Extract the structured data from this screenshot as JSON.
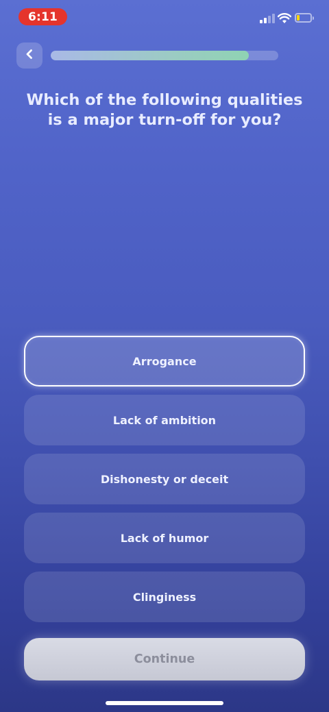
{
  "status_bar": {
    "time": "6:11",
    "signal_bars": 2,
    "battery_level": 0.2,
    "time_pill_color": "#e5342c",
    "battery_fill_color": "#ffd60a"
  },
  "nav": {
    "back_icon": "chevron-left-icon",
    "progress": 0.87
  },
  "question": "Which of the following qualities is a major turn-off for you?",
  "options": [
    {
      "label": "Arrogance",
      "selected": true
    },
    {
      "label": "Lack of ambition",
      "selected": false
    },
    {
      "label": "Dishonesty or deceit",
      "selected": false
    },
    {
      "label": "Lack of humor",
      "selected": false
    },
    {
      "label": "Clinginess",
      "selected": false
    }
  ],
  "continue_label": "Continue",
  "colors": {
    "background_top": "#5b6fd2",
    "background_bottom": "#2c3787",
    "progress_fill": "#8fd3b3"
  }
}
